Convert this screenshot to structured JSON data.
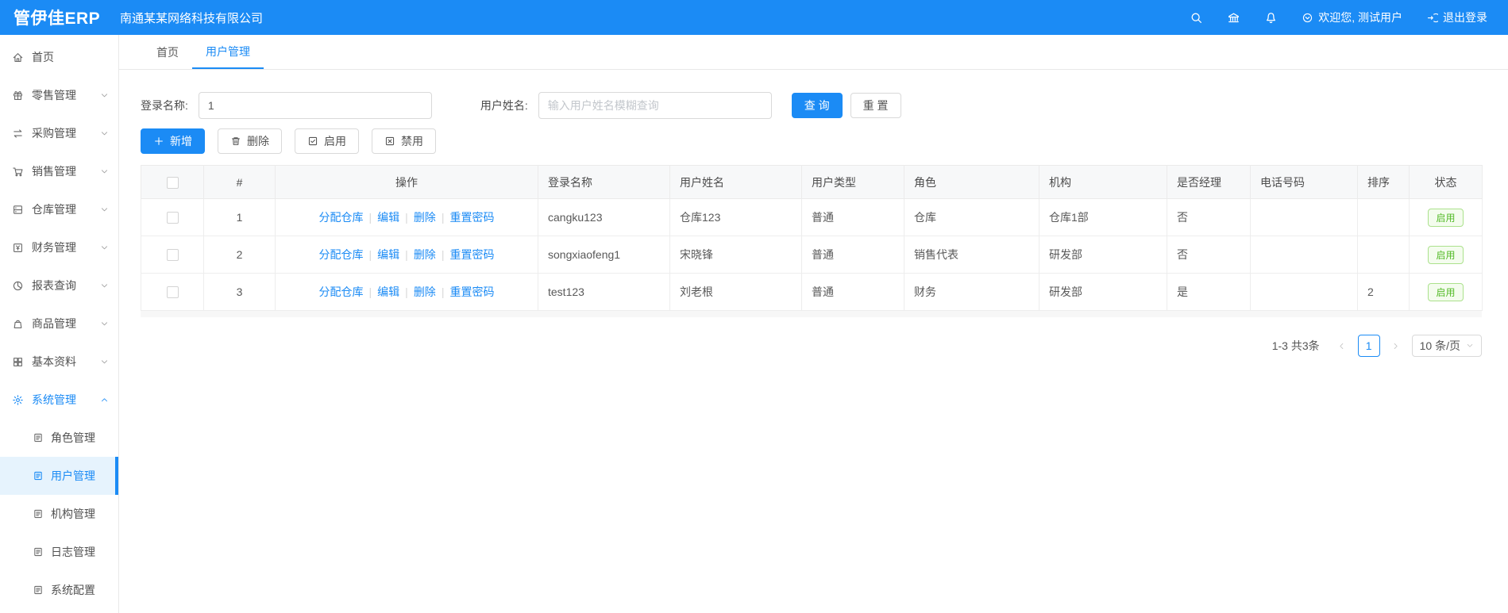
{
  "header": {
    "logo": "管伊佳ERP",
    "company": "南通某某网络科技有限公司",
    "welcome": "欢迎您, 测试用户",
    "logout": "退出登录"
  },
  "icons": {
    "header": [
      "search-icon",
      "bank-icon",
      "bell-icon",
      "down-circle-icon",
      "logout-icon"
    ],
    "sidebar": [
      "home-icon",
      "gift-icon",
      "swap-icon",
      "cart-icon",
      "warehouse-icon",
      "finance-icon",
      "pie-chart-icon",
      "bag-icon",
      "grid-icon",
      "gear-icon",
      "document-icon",
      "chevron-down-icon",
      "chevron-up-icon"
    ]
  },
  "sidebar": {
    "items": [
      {
        "label": "首页"
      },
      {
        "label": "零售管理"
      },
      {
        "label": "采购管理"
      },
      {
        "label": "销售管理"
      },
      {
        "label": "仓库管理"
      },
      {
        "label": "财务管理"
      },
      {
        "label": "报表查询"
      },
      {
        "label": "商品管理"
      },
      {
        "label": "基本资料"
      },
      {
        "label": "系统管理"
      }
    ],
    "children": [
      {
        "label": "角色管理"
      },
      {
        "label": "用户管理"
      },
      {
        "label": "机构管理"
      },
      {
        "label": "日志管理"
      },
      {
        "label": "系统配置"
      }
    ]
  },
  "tabs": [
    {
      "label": "首页"
    },
    {
      "label": "用户管理"
    }
  ],
  "search": {
    "login_label": "登录名称:",
    "login_value": "1",
    "name_label": "用户姓名:",
    "name_placeholder": "输入用户姓名模糊查询",
    "query": "查 询",
    "reset": "重 置"
  },
  "toolbar": {
    "add": "新增",
    "delete": "删除",
    "enable": "启用",
    "disable": "禁用"
  },
  "table": {
    "headers": [
      "#",
      "操作",
      "登录名称",
      "用户姓名",
      "用户类型",
      "角色",
      "机构",
      "是否经理",
      "电话号码",
      "排序",
      "状态"
    ],
    "op_links": [
      "分配仓库",
      "编辑",
      "删除",
      "重置密码"
    ],
    "rows": [
      {
        "index": "1",
        "login": "cangku123",
        "name": "仓库123",
        "type": "普通",
        "role": "仓库",
        "org": "仓库1部",
        "manager": "否",
        "phone": "",
        "sort": "",
        "status": "启用"
      },
      {
        "index": "2",
        "login": "songxiaofeng1",
        "name": "宋晓锋",
        "type": "普通",
        "role": "销售代表",
        "org": "研发部",
        "manager": "否",
        "phone": "",
        "sort": "",
        "status": "启用"
      },
      {
        "index": "3",
        "login": "test123",
        "name": "刘老根",
        "type": "普通",
        "role": "财务",
        "org": "研发部",
        "manager": "是",
        "phone": "",
        "sort": "2",
        "status": "启用"
      }
    ]
  },
  "pagination": {
    "total": "1-3 共3条",
    "page": "1",
    "page_size": "10 条/页"
  },
  "colors": {
    "primary": "#1b8bf5",
    "active_bg": "#e6f3fd",
    "status_green": "#55bb29",
    "border": "#e8e8e8"
  }
}
